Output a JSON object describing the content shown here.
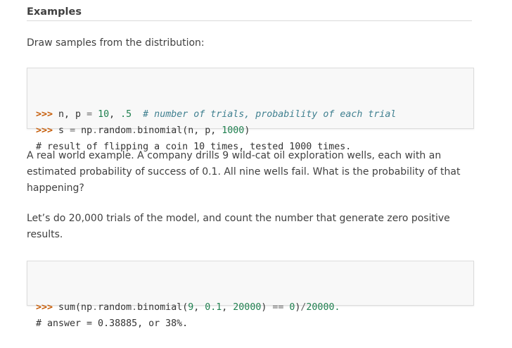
{
  "section": {
    "title": "Examples"
  },
  "intro": {
    "text": "Draw samples from the distribution:"
  },
  "code1": {
    "line1": {
      "prompt": ">>>",
      "a": " n, p ",
      "eq": "=",
      "b": " ",
      "n1": "10",
      "c": ", ",
      "n2": ".5",
      "d": "  ",
      "comment": "# number of trials, probability of each trial"
    },
    "line2": {
      "prompt": ">>>",
      "a": " s ",
      "eq": "=",
      "b": " np",
      "dot1": ".",
      "c": "random",
      "dot2": ".",
      "d": "binomial(n, p, ",
      "n1": "1000",
      "e": ")"
    },
    "line3": {
      "text": "# result of flipping a coin 10 times, tested 1000 times."
    }
  },
  "para2": {
    "text": "A real world example. A company drills 9 wild-cat oil exploration wells, each with an estimated probability of success of 0.1. All nine wells fail. What is the probability of that happening?"
  },
  "para3": {
    "text": "Let’s do 20,000 trials of the model, and count the number that generate zero positive results."
  },
  "code2": {
    "line1": {
      "prompt": ">>>",
      "a": " sum(np",
      "dot1": ".",
      "b": "random",
      "dot2": ".",
      "c": "binomial(",
      "n1": "9",
      "d": ", ",
      "n2": "0.1",
      "e": ", ",
      "n3": "20000",
      "f": ") ",
      "eq": "==",
      "g": " ",
      "n4": "0",
      "h": ")",
      "slash": "/",
      "n5": "20000.",
      "i": ""
    },
    "line2": {
      "text": "# answer = 0.38885, or 38%."
    }
  }
}
